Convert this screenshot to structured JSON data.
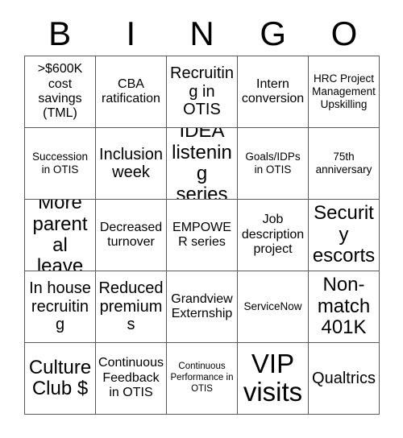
{
  "header": {
    "letters": [
      "B",
      "I",
      "N",
      "G",
      "O"
    ]
  },
  "grid": {
    "rows": [
      [
        {
          "text": ">$600K cost savings (TML)",
          "size": "fs-m"
        },
        {
          "text": "CBA ratification",
          "size": "fs-m"
        },
        {
          "text": "Recruiting in OTIS",
          "size": "fs-l"
        },
        {
          "text": "Intern conversion",
          "size": "fs-m"
        },
        {
          "text": "HRC Project Management Upskilling",
          "size": "fs-s"
        }
      ],
      [
        {
          "text": "Succession in OTIS",
          "size": "fs-s"
        },
        {
          "text": "Inclusion week",
          "size": "fs-l"
        },
        {
          "text": "IDEA listening series",
          "size": "fs-xl"
        },
        {
          "text": "Goals/IDPs in OTIS",
          "size": "fs-s"
        },
        {
          "text": "75th anniversary",
          "size": "fs-s"
        }
      ],
      [
        {
          "text": "More parental leave",
          "size": "fs-xl"
        },
        {
          "text": "Decreased turnover",
          "size": "fs-m"
        },
        {
          "text": "EMPOWER series",
          "size": "fs-m"
        },
        {
          "text": "Job description project",
          "size": "fs-m"
        },
        {
          "text": "Security escorts",
          "size": "fs-xl"
        }
      ],
      [
        {
          "text": "In house recruiting",
          "size": "fs-l"
        },
        {
          "text": "Reduced premiums",
          "size": "fs-l"
        },
        {
          "text": "Grandview Externship",
          "size": "fs-m"
        },
        {
          "text": "ServiceNow",
          "size": "fs-s"
        },
        {
          "text": "Non-match 401K",
          "size": "fs-xl"
        }
      ],
      [
        {
          "text": "Culture Club $",
          "size": "fs-xl"
        },
        {
          "text": "Continuous Feedback in OTIS",
          "size": "fs-m"
        },
        {
          "text": "Continuous Performance in OTIS",
          "size": "fs-xs"
        },
        {
          "text": "VIP visits",
          "size": "fs-xxl"
        },
        {
          "text": "Qualtrics",
          "size": "fs-l"
        }
      ]
    ]
  },
  "colors": {
    "text": "#000000",
    "border": "#595959",
    "background": "#ffffff"
  }
}
